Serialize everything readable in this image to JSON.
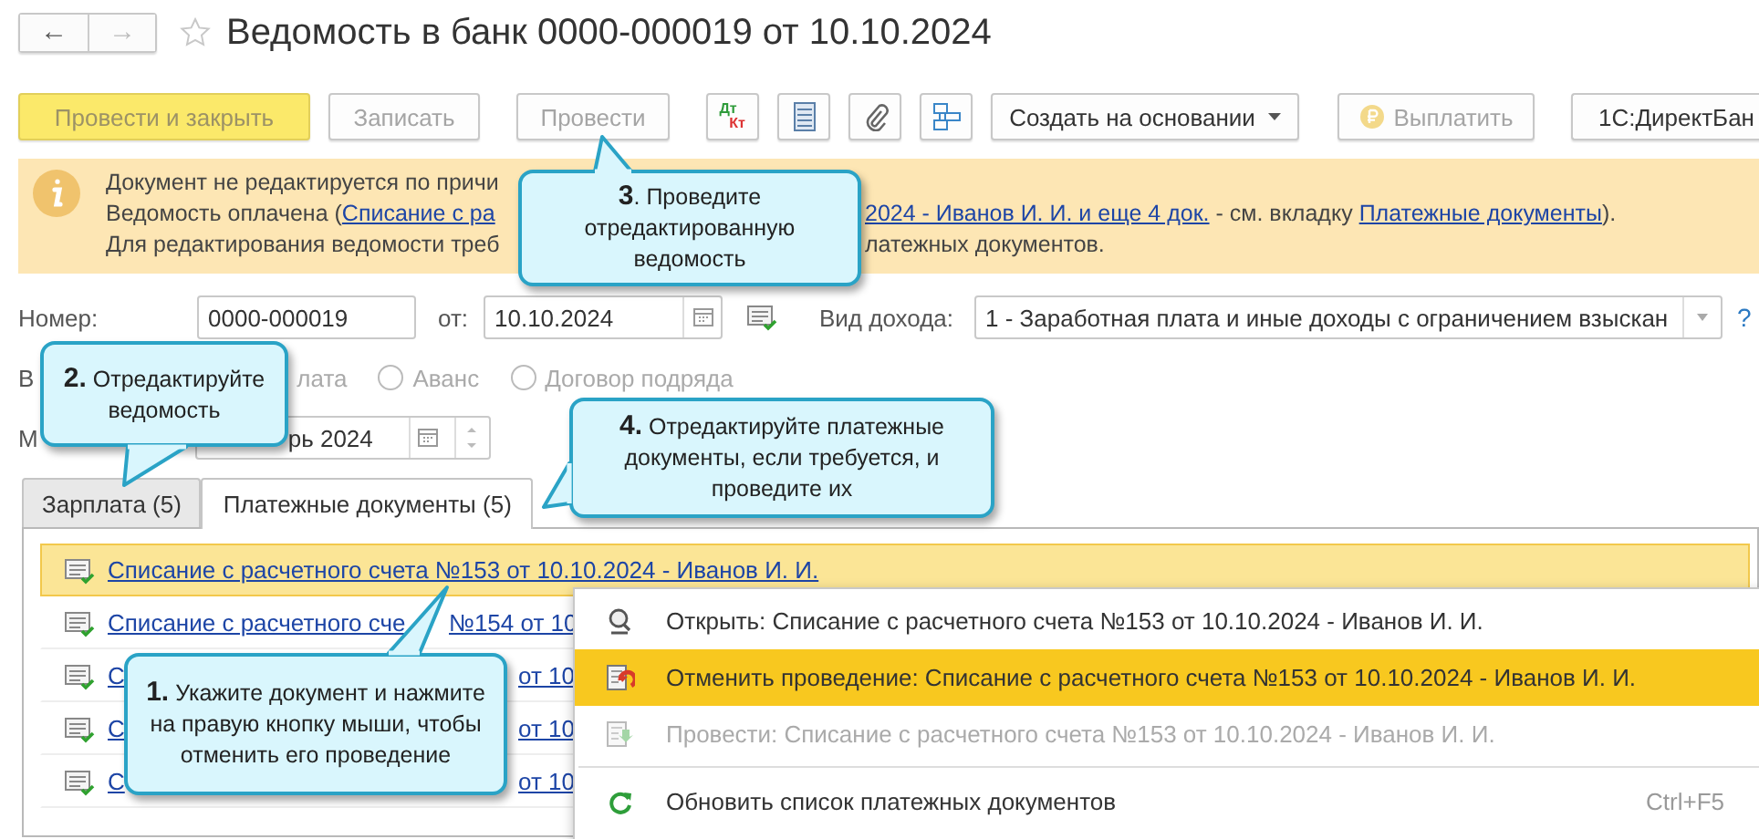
{
  "header": {
    "back": "←",
    "forward": "→",
    "title": "Ведомость в банк 0000-000019 от 10.10.2024",
    "favorite": false
  },
  "toolbar": [
    {
      "kind": "button",
      "label": "Провести и закрыть",
      "default": true,
      "disabled": true
    },
    {
      "kind": "button",
      "label": "Записать",
      "default": false,
      "disabled": true
    },
    {
      "kind": "button",
      "label": "Провести",
      "default": false,
      "disabled": true
    },
    {
      "kind": "dtkt",
      "top": "Дт",
      "bottom": "Кт"
    },
    {
      "kind": "icon"
    },
    {
      "kind": "icon"
    },
    {
      "kind": "icon"
    },
    {
      "kind": "menu",
      "label": "Создать на основании",
      "default": false,
      "disabled": false
    },
    {
      "kind": "coin",
      "label": "Выплатить",
      "default": false,
      "disabled": true
    },
    {
      "kind": "button",
      "label": "1С:ДиректБан",
      "default": false,
      "disabled": false
    }
  ],
  "notice": {
    "line_1": "Документ не редактируется по причи",
    "line_2_left": [
      {
        "text": "Ведомость оплачена (",
        "link": false
      },
      {
        "text": "Списание с ра",
        "link": true
      }
    ],
    "line_2_right": [
      {
        "text": "2024 - Иванов И. И. и еще 4 док.",
        "link": true
      },
      {
        "text": " - см. вкладку ",
        "link": false
      },
      {
        "text": "Платежные документы",
        "link": true
      },
      {
        "text": ").",
        "link": false
      }
    ],
    "line_3_left": "Для редактирования ведомости треб",
    "line_3_right": "латежных документов."
  },
  "number": {
    "label": "Номер:",
    "value": "0000-000019"
  },
  "date": {
    "label": "от:",
    "value": "10.10.2024"
  },
  "income": {
    "label": "Вид дохода:",
    "value": "1 - Заработная плата и иные доходы с ограничением взыскан",
    "help": "?"
  },
  "payment_type": {
    "label": "В",
    "first_option": "лата",
    "options": [
      {
        "label": "Аванс",
        "selected": false
      },
      {
        "label": "Договор подряда",
        "selected": false
      }
    ]
  },
  "month": {
    "label": "М",
    "value": "рь 2024"
  },
  "tabs": [
    {
      "label": "Зарплата (5)",
      "selected": false
    },
    {
      "label": "Платежные документы (5)",
      "selected": true
    }
  ],
  "documents": [
    {
      "parts": [
        "Списание с расчетного счета №153 от 10.10.2024 - Иванов И. И."
      ],
      "selected": true
    },
    {
      "parts": [
        "Списание с расчетного сче",
        "№154 от 10"
      ],
      "selected": false
    },
    {
      "parts": [
        "С",
        "от 10"
      ],
      "selected": false
    },
    {
      "parts": [
        "С",
        "от 10"
      ],
      "selected": false
    },
    {
      "parts": [
        "С",
        "от 10"
      ],
      "selected": false
    }
  ],
  "context_menu": [
    {
      "label": "Открыть: Списание с расчетного счета №153 от 10.10.2024 - Иванов И. И.",
      "selected": false,
      "disabled": false
    },
    {
      "label": "Отменить проведение: Списание с расчетного счета №153 от 10.10.2024 - Иванов И. И.",
      "selected": true,
      "disabled": false
    },
    {
      "label": "Провести: Списание с расчетного счета №153 от 10.10.2024 - Иванов И. И.",
      "selected": false,
      "disabled": true
    },
    {
      "label": "Обновить список платежных документов",
      "selected": false,
      "disabled": false,
      "separator_before": true,
      "shortcut": "Ctrl+F5"
    }
  ],
  "callouts": [
    {
      "text": "**3**. Проведите отредактированную ведомость"
    },
    {
      "text": "**2.** Отредактируйте ведомость"
    },
    {
      "text": "**4.** Отредактируйте платежные документы, если требуется, и проведите их"
    },
    {
      "text": "**1.** Укажите документ и нажмите на правую кнопку мыши, чтобы отменить его проведение"
    }
  ]
}
